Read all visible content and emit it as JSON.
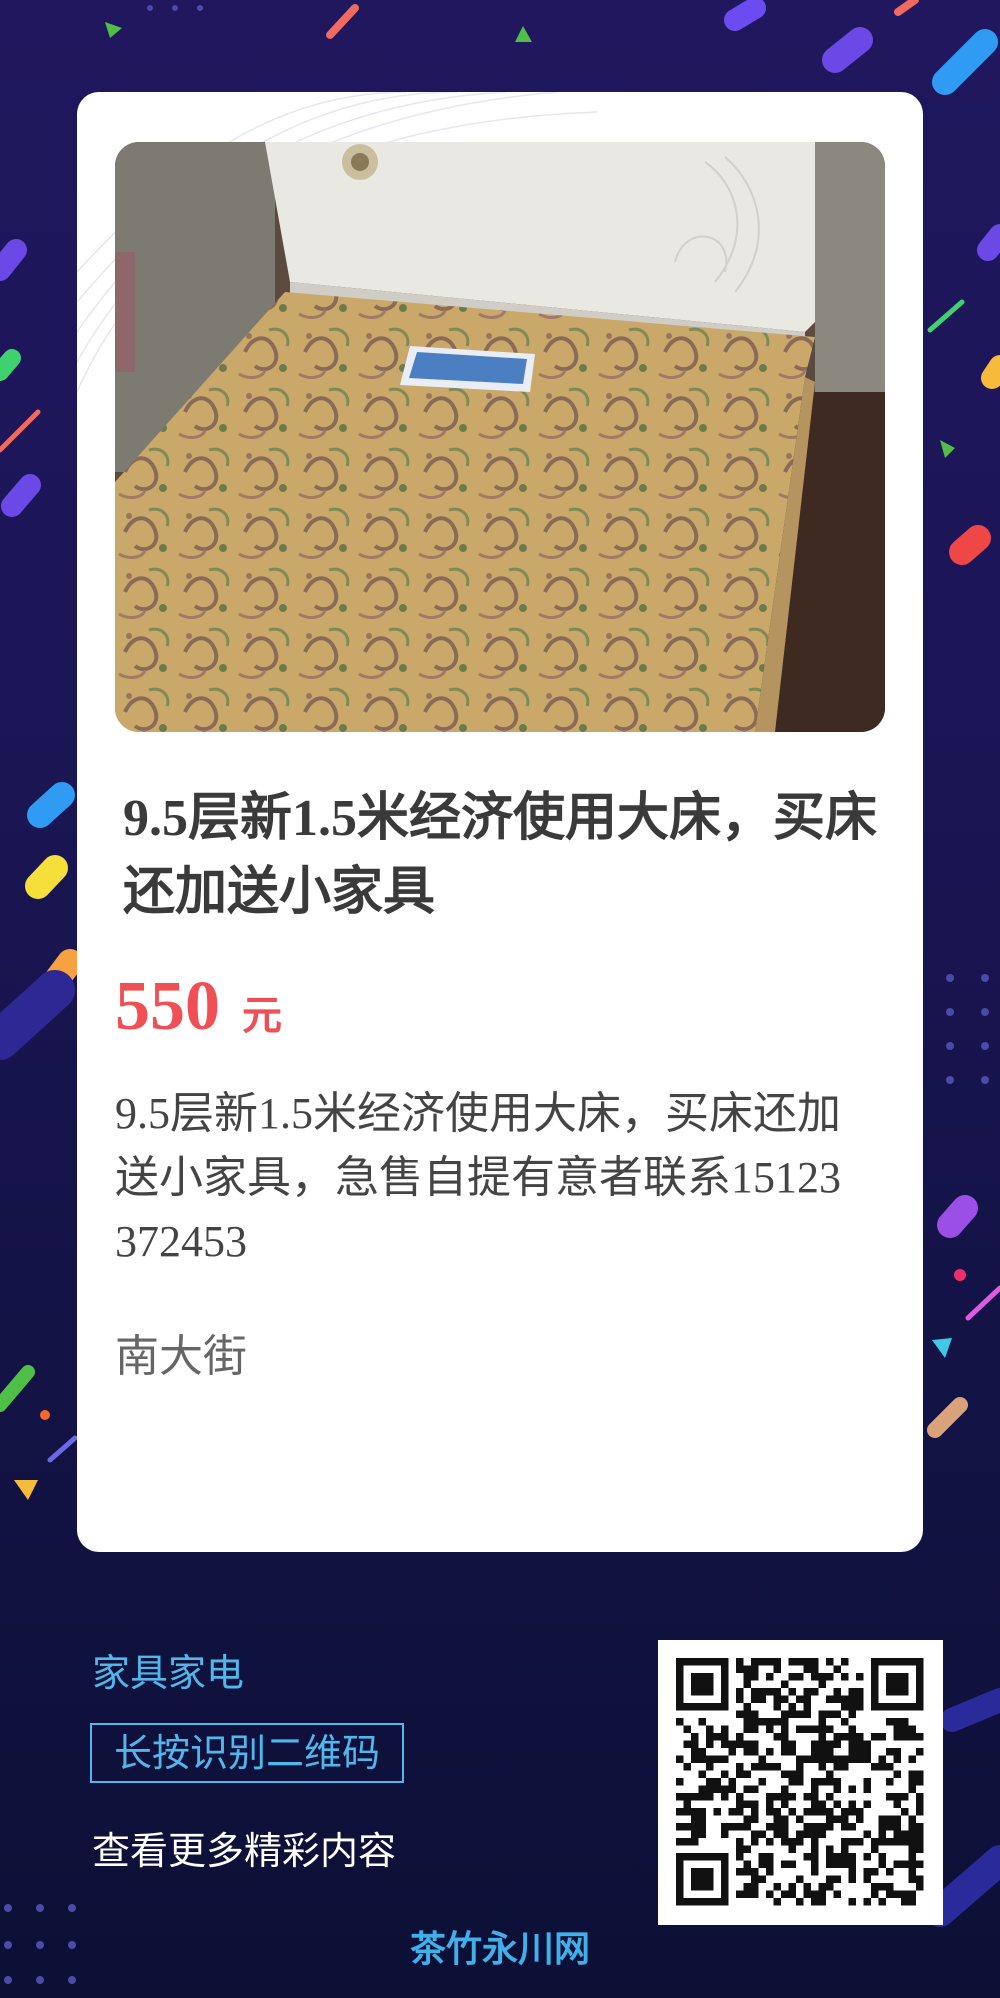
{
  "post": {
    "title": "9.5层新1.5米经济使用大床，买床还加送小家具",
    "price": "550",
    "price_unit": "元",
    "description": "9.5层新1.5米经济使用大床，买床还加送小家具，急售自提有意者联系15123372453",
    "location": "南大街"
  },
  "footer": {
    "category": "家具家电",
    "qr_hint": "长按识别二维码",
    "more_text": "查看更多精彩内容",
    "site_name": "茶竹永川网"
  },
  "colors": {
    "accent_price": "#ef4f55",
    "accent_link": "#4fb7ec",
    "background": "#1b1656"
  }
}
